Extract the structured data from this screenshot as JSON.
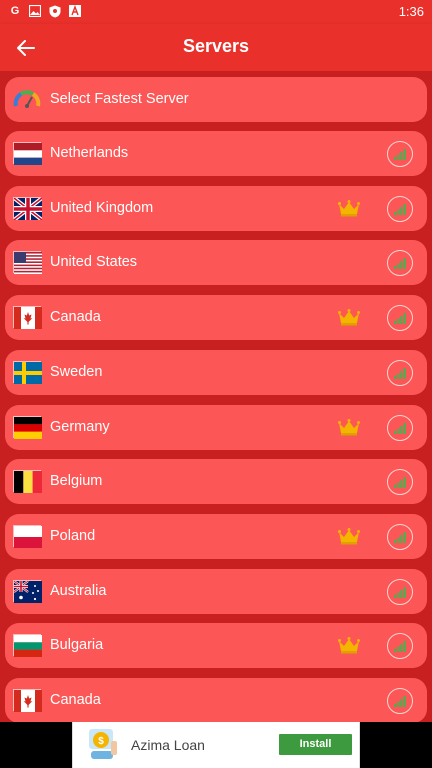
{
  "status_bar": {
    "time": "1:36",
    "icons": [
      "google-icon",
      "image-icon",
      "shield-icon",
      "a-icon"
    ]
  },
  "app_bar": {
    "title": "Servers",
    "back_icon": "arrow-left-icon"
  },
  "fastest": {
    "label": "Select Fastest Server",
    "icon": "speedometer-icon"
  },
  "servers": [
    {
      "name": "Netherlands",
      "flag": "nl",
      "premium": false
    },
    {
      "name": "United Kingdom",
      "flag": "uk",
      "premium": true
    },
    {
      "name": "United States",
      "flag": "us",
      "premium": false
    },
    {
      "name": "Canada",
      "flag": "ca",
      "premium": true
    },
    {
      "name": "Sweden",
      "flag": "se",
      "premium": false
    },
    {
      "name": "Germany",
      "flag": "de",
      "premium": true
    },
    {
      "name": "Belgium",
      "flag": "be",
      "premium": false
    },
    {
      "name": "Poland",
      "flag": "pl",
      "premium": true
    },
    {
      "name": "Australia",
      "flag": "au",
      "premium": false
    },
    {
      "name": "Bulgaria",
      "flag": "bg",
      "premium": true
    },
    {
      "name": "Canada",
      "flag": "ca",
      "premium": false
    }
  ],
  "ad": {
    "app_name": "Azima Loan",
    "install_label": "Install"
  },
  "colors": {
    "background": "#c82020",
    "appbar": "#e9302b",
    "row": "#fc5656",
    "crown": "#f5b400",
    "signal": "#4caf50",
    "install": "#3d9a3e"
  }
}
